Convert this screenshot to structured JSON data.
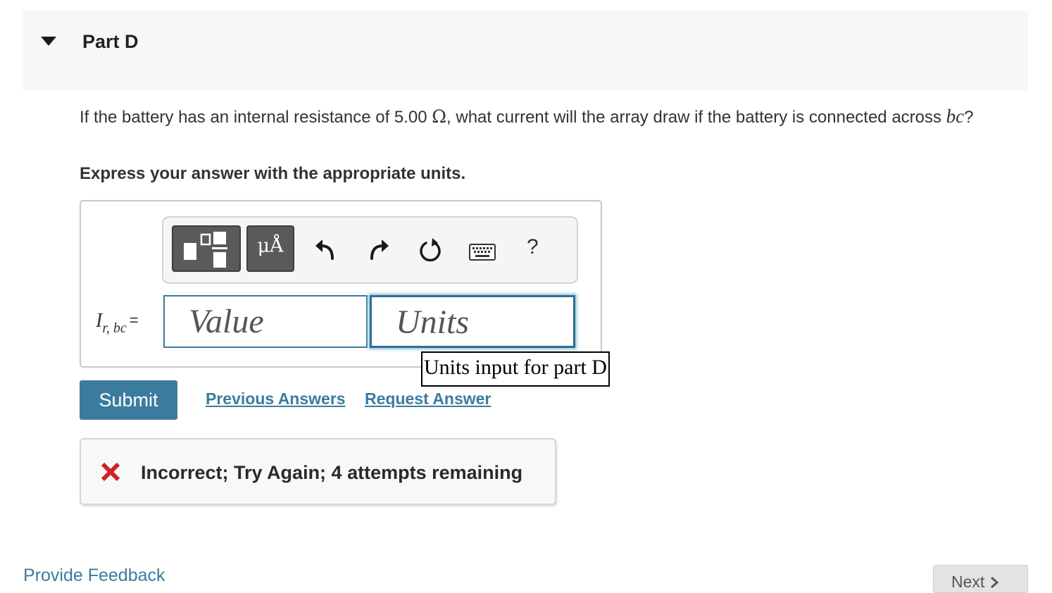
{
  "part": {
    "title": "Part D",
    "collapse_icon": "triangle-down-icon"
  },
  "question": {
    "text_before": "If the battery has an internal resistance of 5.00 ",
    "ohm_symbol": "Ω",
    "text_after": ", what current will the array draw if the battery is connected across ",
    "math_term": "bc",
    "question_mark": "?"
  },
  "instruction": "Express your answer with the appropriate units.",
  "toolbar": {
    "templates_icon": "templates-icon",
    "units_label": "μÅ",
    "undo_icon": "undo-icon",
    "redo_icon": "redo-icon",
    "reset_icon": "reset-icon",
    "keyboard_icon": "keyboard-icon",
    "help_label": "?"
  },
  "equation": {
    "variable": "I",
    "subscript": "r, bc",
    "equals": "="
  },
  "inputs": {
    "value_placeholder": "Value",
    "units_placeholder": "Units"
  },
  "tooltip": "Units input for part D",
  "actions": {
    "submit_label": "Submit",
    "previous_answers": "Previous Answers",
    "request_answer": "Request Answer"
  },
  "feedback": {
    "icon": "x-icon",
    "message": "Incorrect; Try Again; 4 attempts remaining",
    "status_color": "#d0202a"
  },
  "footer": {
    "provide_feedback": "Provide Feedback",
    "next_label": "Next",
    "next_icon": "chevron-right-icon"
  },
  "colors": {
    "accent": "#3b7c9e",
    "header_bg": "#f7f7f7"
  }
}
